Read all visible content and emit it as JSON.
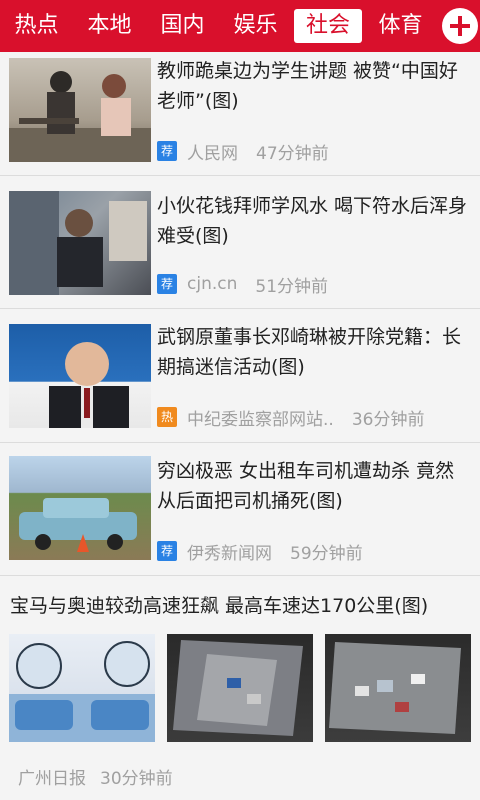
{
  "nav": {
    "tabs": [
      {
        "label": "热点"
      },
      {
        "label": "本地"
      },
      {
        "label": "国内"
      },
      {
        "label": "娱乐"
      },
      {
        "label": "社会"
      },
      {
        "label": "体育"
      }
    ],
    "active_tab": "社会",
    "add_icon": "plus-circle-icon"
  },
  "feed": [
    {
      "title": "教师跪桌边为学生讲题 被赞“中国好老师”(图)",
      "badge": "荐",
      "source": "人民网",
      "time": "47分钟前"
    },
    {
      "title": "小伙花钱拜师学风水 喝下符水后浑身难受(图)",
      "badge": "荐",
      "source": "cjn.cn",
      "time": "51分钟前"
    },
    {
      "title": "武钢原董事长邓崎琳被开除党籍：长期搞迷信活动(图)",
      "badge": "热",
      "source": "中纪委监察部网站..",
      "time": "36分钟前"
    },
    {
      "title": "穷凶极恶 女出租车司机遭劫杀 竟然从后面把司机捅死(图)",
      "badge": "荐",
      "source": "伊秀新闻网",
      "time": "59分钟前"
    }
  ],
  "gallery_item": {
    "title": "宝马与奥迪较劲高速狂飙 最高车速达170公里(图)",
    "source": "广州日报",
    "time": "30分钟前"
  },
  "colors": {
    "brand_red": "#d9102c",
    "badge_recommend": "#2a82e4",
    "badge_hot": "#f08a1e"
  }
}
